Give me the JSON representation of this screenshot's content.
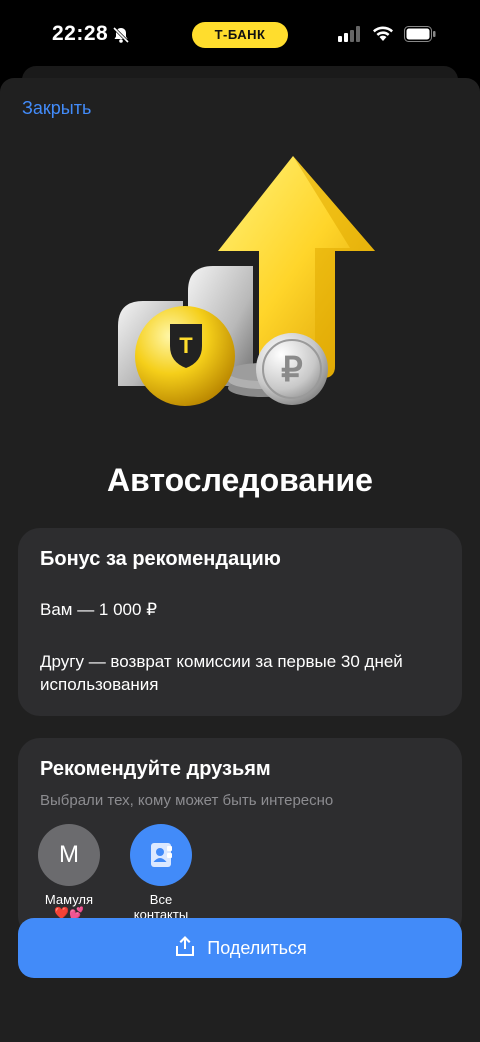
{
  "status_bar": {
    "time": "22:28",
    "carrier_pill": "Т-БАНК",
    "icons": [
      "bell-slash-icon",
      "signal-icon",
      "wifi-icon",
      "battery-icon"
    ]
  },
  "sheet": {
    "close_label": "Закрыть",
    "hero_image": "arrow-up-coins-illustration",
    "title": "Автоследование"
  },
  "bonus_card": {
    "title": "Бонус за рекомендацию",
    "you": "Вам — 1 000 ₽",
    "friend": "Другу — возврат комиссии за первые 30 дней использования"
  },
  "recommend_card": {
    "title": "Рекомендуйте друзьям",
    "subtitle": "Выбрали тех, кому может быть интересно",
    "contacts": [
      {
        "initial": "М",
        "name": "Мамуля",
        "emoji": "❤️💕"
      },
      {
        "name_line1": "Все",
        "name_line2": "контакты",
        "icon": "contacts-book-icon"
      }
    ]
  },
  "share_button": {
    "label": "Поделиться",
    "icon": "share-upload-icon"
  },
  "colors": {
    "accent_blue": "#428bf9",
    "brand_yellow": "#ffdd2d",
    "card_bg": "#2d2d2f",
    "sheet_bg": "#202020"
  }
}
